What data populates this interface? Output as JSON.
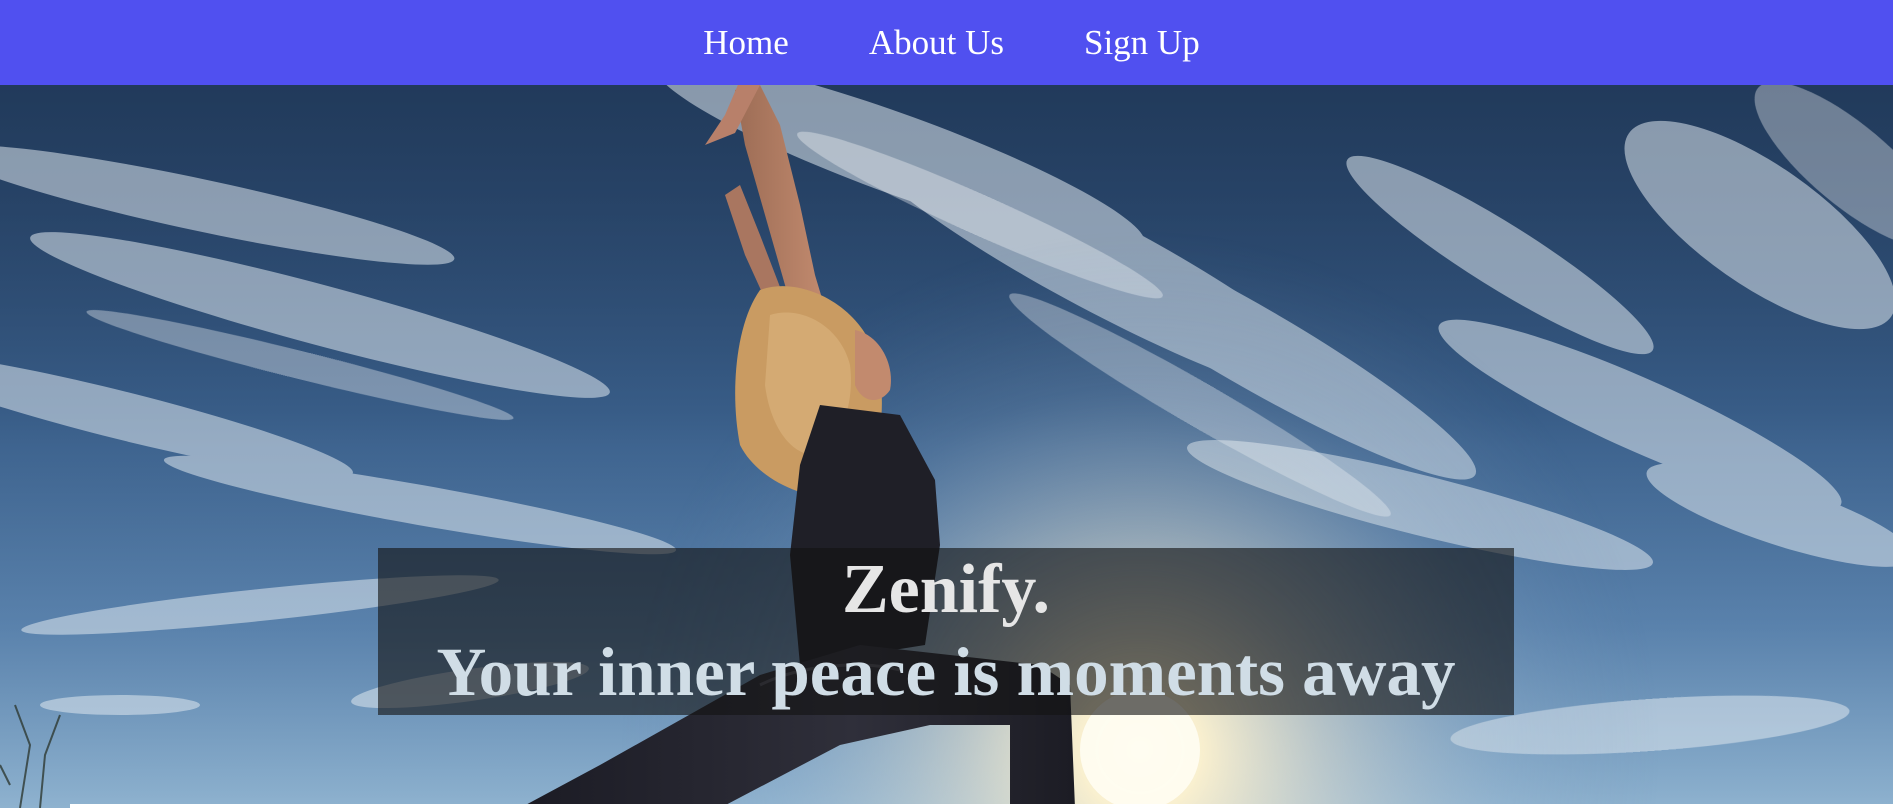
{
  "nav": {
    "items": [
      {
        "label": "Home"
      },
      {
        "label": "About Us"
      },
      {
        "label": "Sign Up"
      }
    ],
    "background": "#5050F0",
    "text_color": "#FFFFFF"
  },
  "hero": {
    "image": "yoga-woman-warrior-pose-sky-photo",
    "brand": "Zenify.",
    "tagline": "Your inner peace is moments away"
  }
}
